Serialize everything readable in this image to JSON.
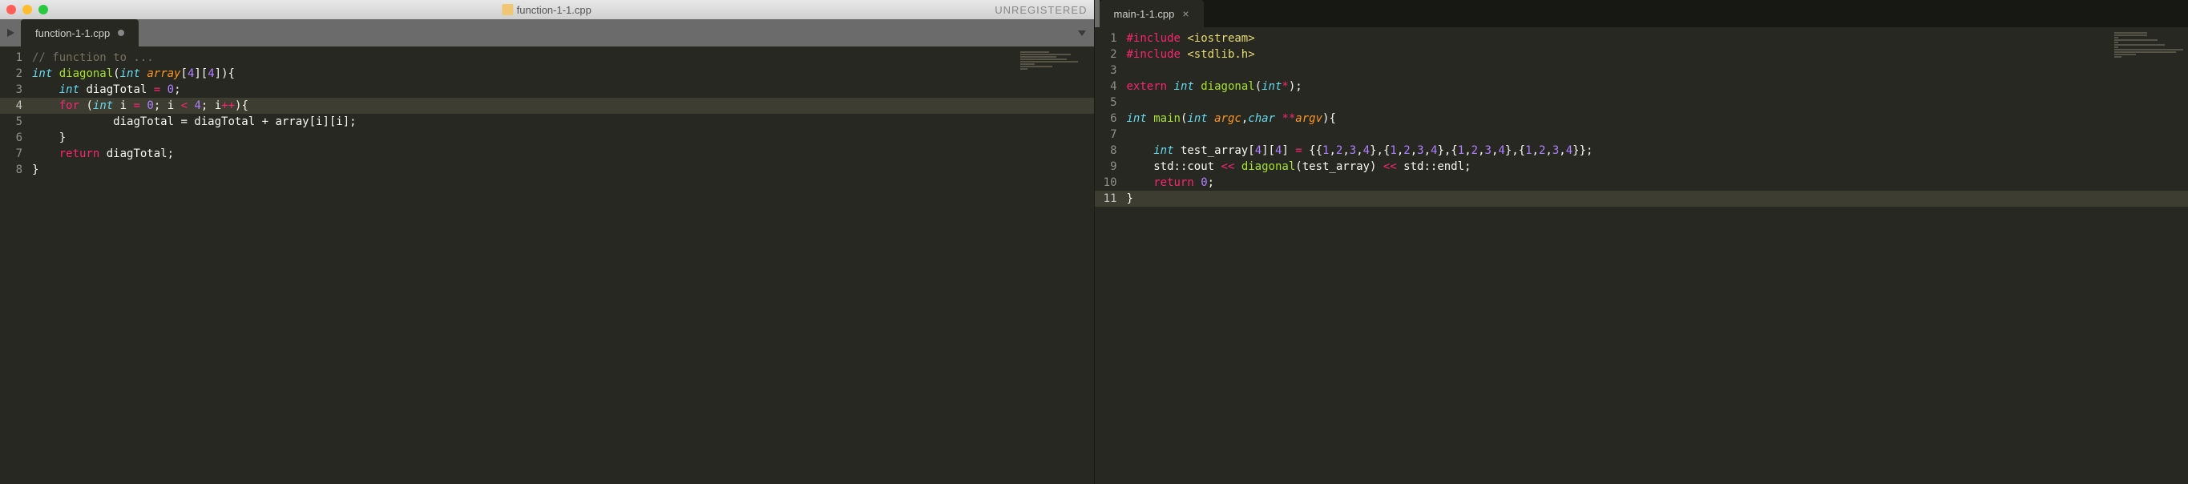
{
  "left": {
    "titlebar_filename": "function-1-1.cpp",
    "unregistered": "UNREGISTERED",
    "tab_label": "function-1-1.cpp",
    "line_numbers": [
      "1",
      "2",
      "3",
      "4",
      "5",
      "6",
      "7",
      "8"
    ],
    "highlighted_line_index": 3,
    "code": {
      "l1_comment": "// function to ...",
      "l2_int": "int",
      "l2_func": "diagonal",
      "l2_int2": "int",
      "l2_param": "array",
      "l2_dim": "[4][4]",
      "l3_int": "int",
      "l3_var": "diagTotal",
      "l3_eq": "=",
      "l3_zero": "0",
      "l4_for": "for",
      "l4_int": "int",
      "l4_i": "i",
      "l4_eq": "=",
      "l4_z": "0",
      "l4_lt": "<",
      "l4_four": "4",
      "l4_inc": "++",
      "l5_assign": "diagTotal = diagTotal + array[i][i];",
      "l6_brace": "}",
      "l7_return": "return",
      "l7_var": "diagTotal",
      "l8_brace": "}"
    }
  },
  "right": {
    "tab_label": "main-1-1.cpp",
    "line_numbers": [
      "1",
      "2",
      "3",
      "4",
      "5",
      "6",
      "7",
      "8",
      "9",
      "10",
      "11"
    ],
    "highlighted_line_index": 10,
    "code": {
      "l1_include": "#include",
      "l1_hdr": "<iostream>",
      "l2_include": "#include",
      "l2_hdr": "<stdlib.h>",
      "l4_extern": "extern",
      "l4_int": "int",
      "l4_func": "diagonal",
      "l4_int2": "int",
      "l4_star": "*",
      "l6_int": "int",
      "l6_main": "main",
      "l6_int2": "int",
      "l6_argc": "argc",
      "l6_char": "char",
      "l6_argv": "argv",
      "l8_int": "int",
      "l8_var": "test_array",
      "l8_dim": "[4][4]",
      "l8_eq": "=",
      "l8_vals": "{{1,2,3,4},{1,2,3,4},{1,2,3,4},{1,2,3,4}}",
      "l9_std": "std",
      "l9_cout": "cout",
      "l9_func": "diagonal",
      "l9_arg": "test_array",
      "l9_endl": "endl",
      "l10_return": "return",
      "l10_zero": "0",
      "l11_brace": "}"
    }
  }
}
